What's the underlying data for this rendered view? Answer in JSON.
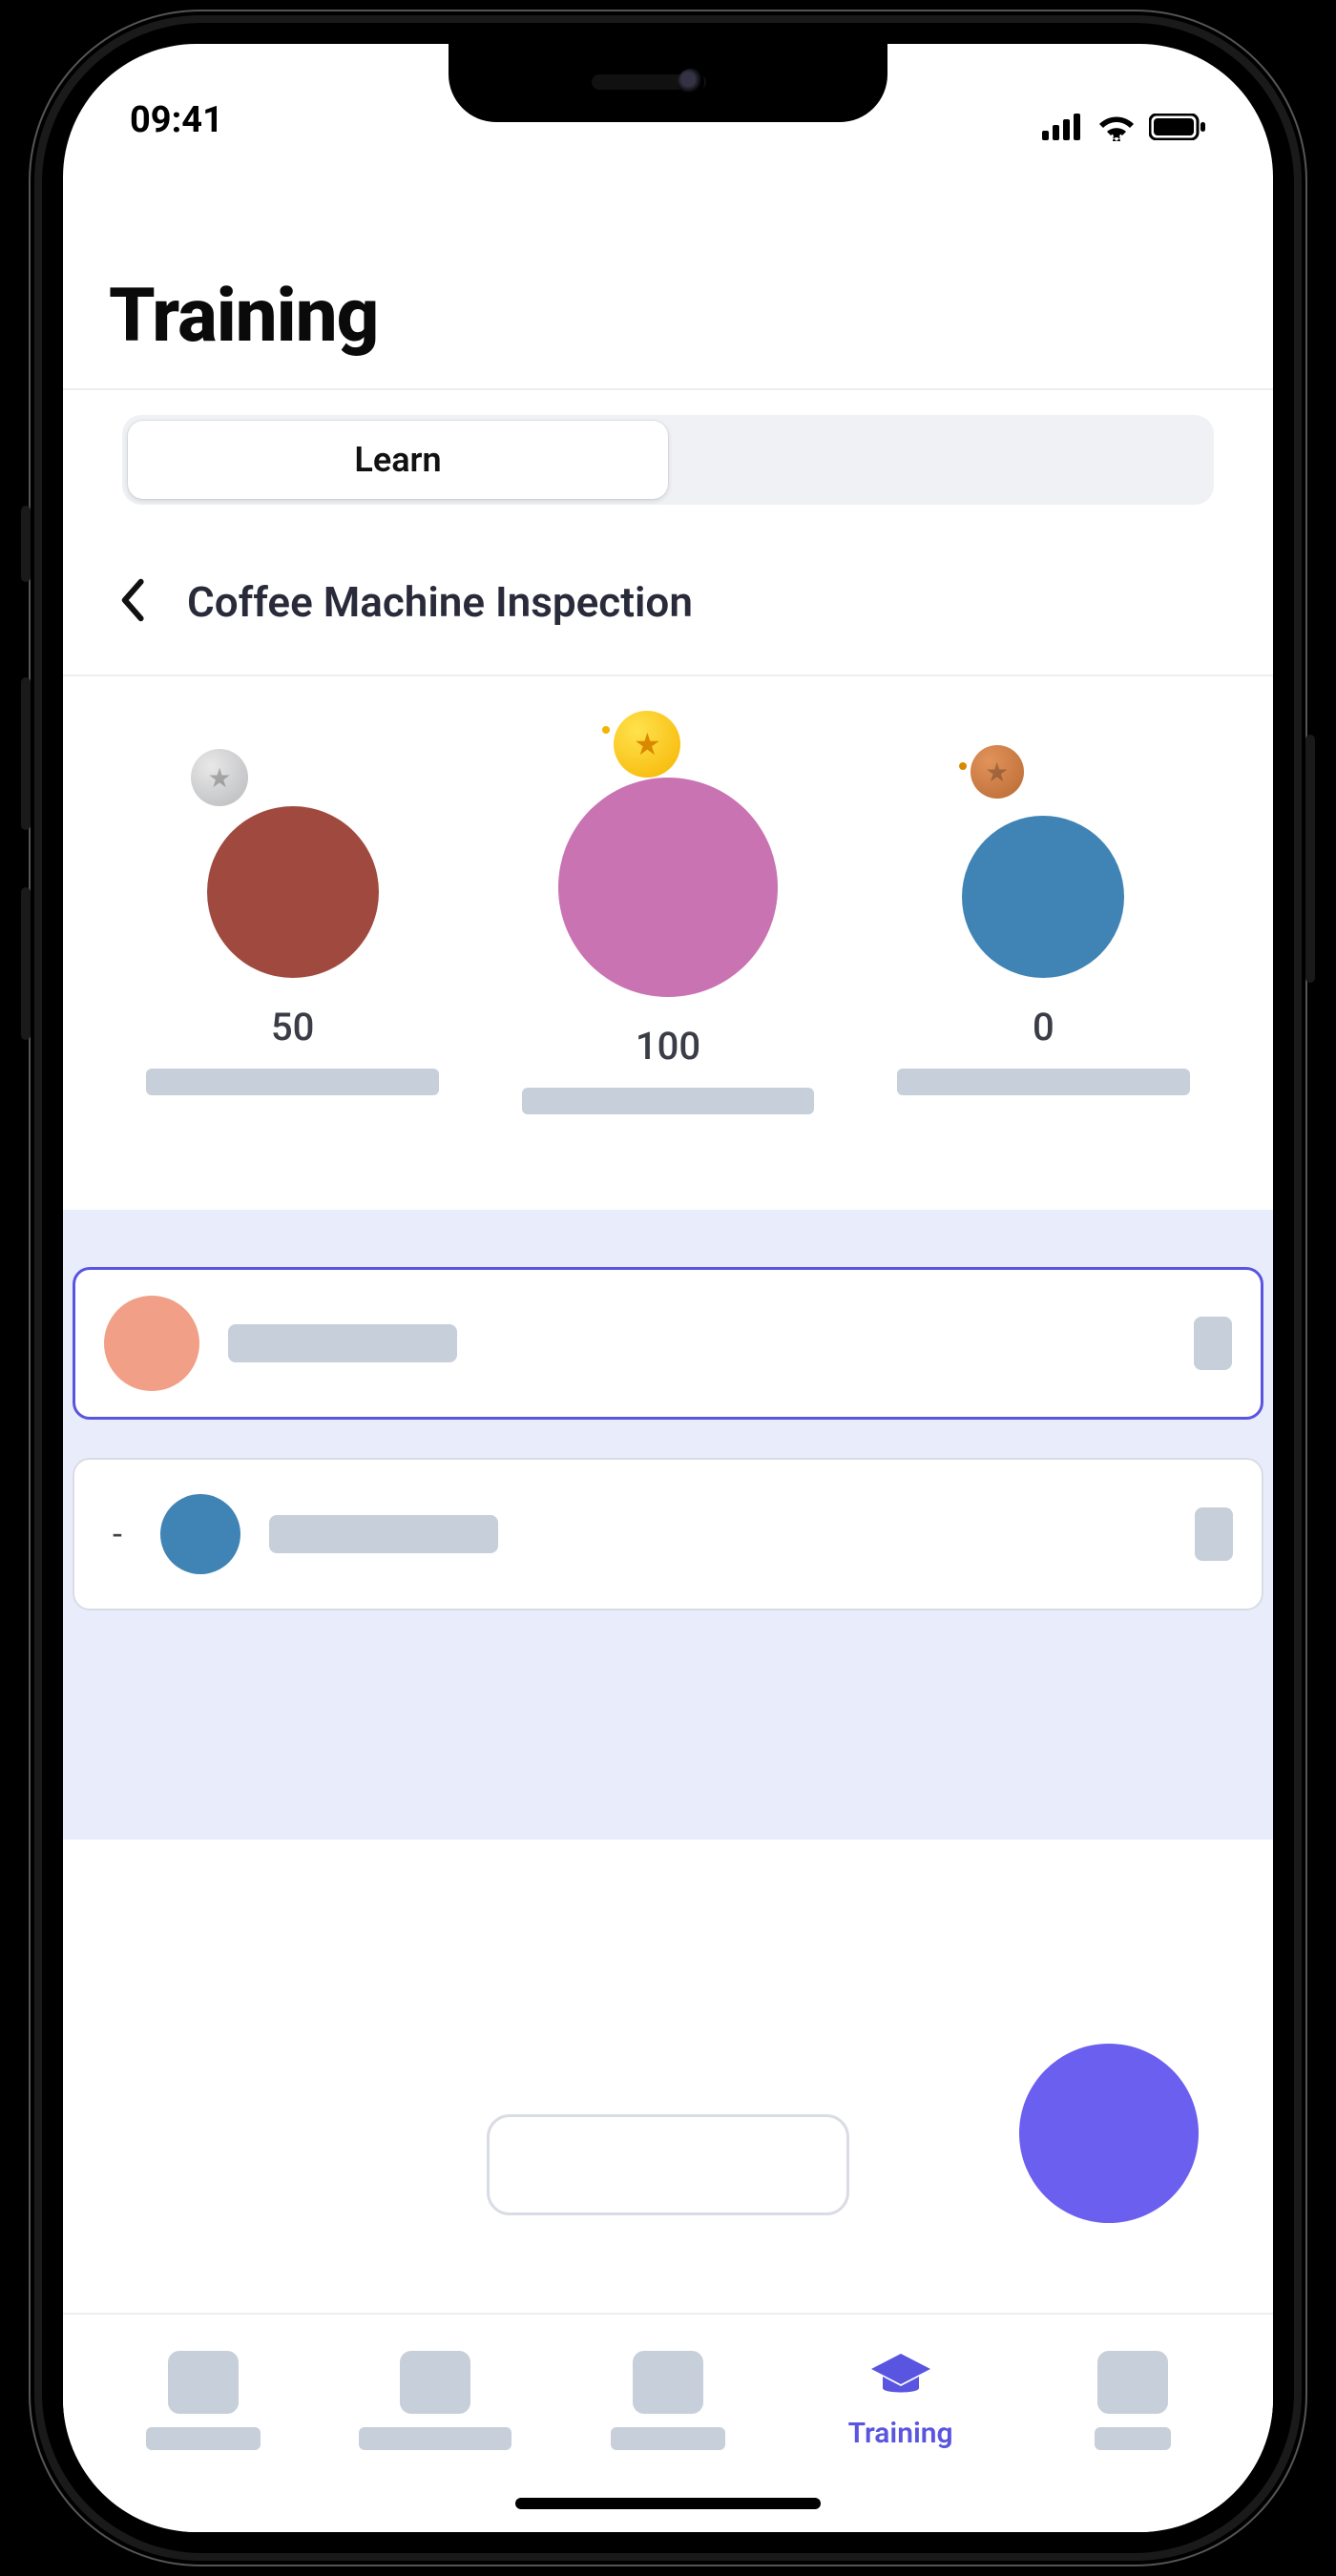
{
  "status": {
    "time": "09:41"
  },
  "page": {
    "title": "Training"
  },
  "segmented": {
    "items": [
      {
        "label": "Learn",
        "active": true
      },
      {
        "label": "",
        "active": false
      }
    ]
  },
  "breadcrumb": {
    "title": "Coffee Machine Inspection"
  },
  "leaderboard": [
    {
      "medal": "silver",
      "score": "50",
      "avatar_color": "#a04a3f"
    },
    {
      "medal": "gold",
      "score": "100",
      "avatar_color": "#c973b2"
    },
    {
      "medal": "bronze",
      "score": "0",
      "avatar_color": "#3f84b5"
    }
  ],
  "list": [
    {
      "rank": "",
      "avatar_color": "#f19f87",
      "selected": true
    },
    {
      "rank": "-",
      "avatar_color": "#3f84b5",
      "selected": false
    }
  ],
  "tabs": {
    "active_index": 3,
    "items": [
      {
        "label": ""
      },
      {
        "label": ""
      },
      {
        "label": ""
      },
      {
        "label": "Training"
      },
      {
        "label": ""
      }
    ]
  },
  "colors": {
    "accent": "#5a55e0",
    "panel_bg": "#e9ecfb",
    "stub": "#c7cfda"
  }
}
